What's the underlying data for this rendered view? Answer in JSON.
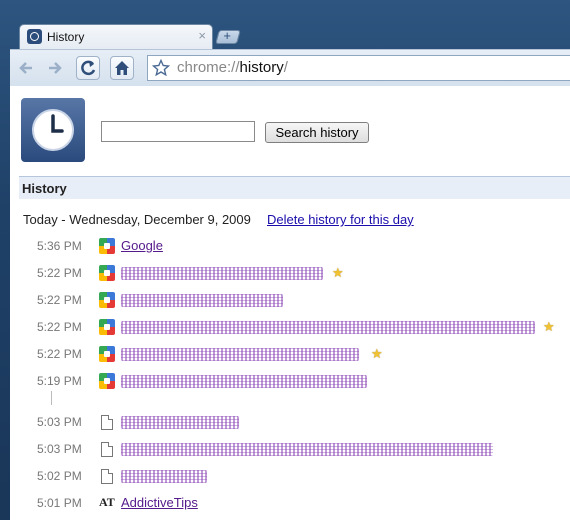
{
  "tab": {
    "title": "History",
    "close": "×",
    "new_tab": "+"
  },
  "toolbar": {
    "back_icon": "back-arrow-icon",
    "forward_icon": "forward-arrow-icon",
    "reload_icon": "reload-icon",
    "home_icon": "home-icon",
    "bookmark_icon": "star-icon",
    "url_scheme": "chrome://",
    "url_host": "history",
    "url_tail": "/"
  },
  "search": {
    "value": "",
    "button_label": "Search history"
  },
  "section": {
    "title": "History"
  },
  "day": {
    "heading": "Today - Wednesday, December 9, 2009",
    "delete_label": "Delete history for this day"
  },
  "entries": [
    {
      "time": "5:36 PM",
      "icon": "google-icon",
      "title": "Google",
      "starred": false
    },
    {
      "time": "5:22 PM",
      "icon": "google-icon",
      "title": "",
      "starred": true
    },
    {
      "time": "5:22 PM",
      "icon": "google-icon",
      "title": "",
      "starred": false
    },
    {
      "time": "5:22 PM",
      "icon": "google-icon",
      "title": "",
      "starred": true
    },
    {
      "time": "5:22 PM",
      "icon": "google-icon",
      "title": "",
      "starred": true
    },
    {
      "time": "5:19 PM",
      "icon": "google-icon",
      "title": "",
      "starred": false
    },
    {
      "time": "5:03 PM",
      "icon": "page-icon",
      "title": "",
      "starred": false
    },
    {
      "time": "5:03 PM",
      "icon": "page-icon",
      "title": "",
      "starred": false
    },
    {
      "time": "5:02 PM",
      "icon": "page-icon",
      "title": "",
      "starred": false
    },
    {
      "time": "5:01 PM",
      "icon": "addictivetips-icon",
      "title": "AddictiveTips",
      "starred": false
    }
  ],
  "colors": {
    "link_visited": "#551a8b",
    "link": "#1a0dab",
    "section_bar": "#e8eef8",
    "star": "#f1c232"
  }
}
